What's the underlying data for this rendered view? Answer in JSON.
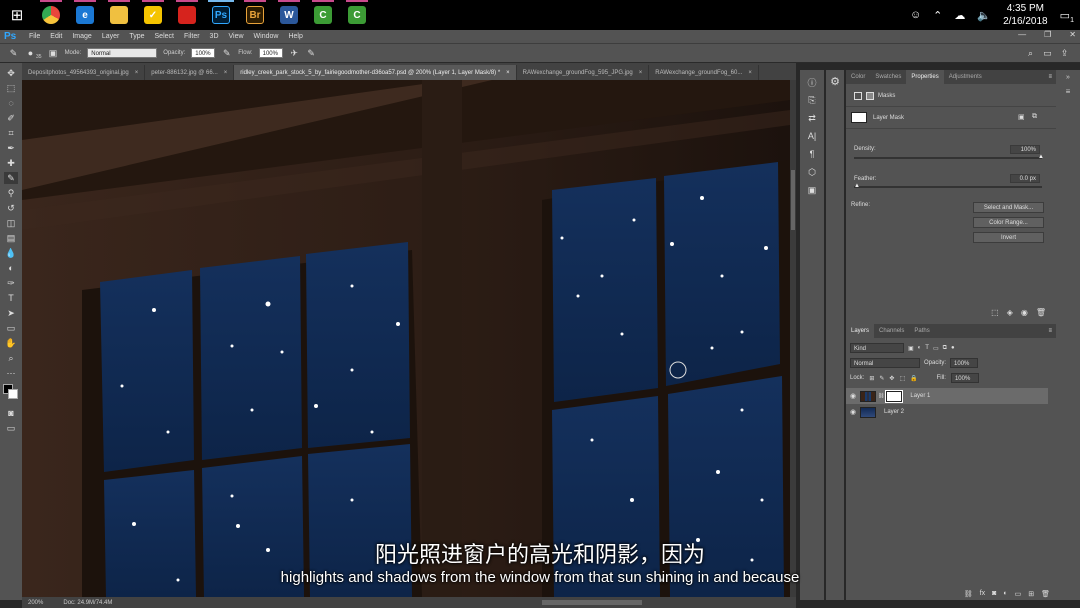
{
  "taskbar": {
    "time": "4:35 PM",
    "date": "2/16/2018",
    "notification_count": "1",
    "apps": [
      {
        "name": "chrome-icon",
        "label": "",
        "color": "#e8453c"
      },
      {
        "name": "edge-icon",
        "label": "e",
        "color": "#1b78d4"
      },
      {
        "name": "file-explorer-icon",
        "label": "",
        "color": "#f0c040"
      },
      {
        "name": "norton-icon",
        "label": "✓",
        "color": "#f5c400"
      },
      {
        "name": "app-red-icon",
        "label": "",
        "color": "#d6231d"
      },
      {
        "name": "photoshop-icon",
        "label": "Ps",
        "color": "#001d34"
      },
      {
        "name": "bridge-icon",
        "label": "Br",
        "color": "#2d1c00"
      },
      {
        "name": "word-icon",
        "label": "W",
        "color": "#2b579a"
      },
      {
        "name": "camtasia-icon",
        "label": "C",
        "color": "#3c9b35"
      },
      {
        "name": "camtasia-recorder-icon",
        "label": "C",
        "color": "#3c9b35"
      }
    ]
  },
  "menubar": {
    "logo": "Ps",
    "items": [
      "File",
      "Edit",
      "Image",
      "Layer",
      "Type",
      "Select",
      "Filter",
      "3D",
      "View",
      "Window",
      "Help"
    ]
  },
  "options": {
    "brush_size": "35",
    "mode_label": "Mode:",
    "mode_value": "Normal",
    "opacity_label": "Opacity:",
    "opacity_value": "100%",
    "flow_label": "Flow:",
    "flow_value": "100%"
  },
  "tabs": [
    {
      "label": "Depositphotos_49564393_original.jpg",
      "active": false
    },
    {
      "label": "peter-886132.jpg @ 66...",
      "active": false
    },
    {
      "label": "ridley_creek_park_stock_5_by_fairiegoodmother-d36oa57.psd @ 200% (Layer 1, Layer Mask/8) *",
      "active": true
    },
    {
      "label": "RAWexchange_groundFog_595_JPG.jpg",
      "active": false
    },
    {
      "label": "RAWexchange_groundFog_60...",
      "active": false
    }
  ],
  "status": {
    "zoom": "200%",
    "doc": "Doc: 24.9M/74.4M"
  },
  "properties": {
    "tabs": [
      "Color",
      "Swatches",
      "Properties",
      "Adjustments"
    ],
    "active_tab": "Properties",
    "masks_label": "Masks",
    "layer_mask_label": "Layer Mask",
    "density_label": "Density:",
    "density_value": "100%",
    "density_level": 1.0,
    "feather_label": "Feather:",
    "feather_value": "0.0 px",
    "feather_level": 0.0,
    "refine_label": "Refine:",
    "select_and_mask": "Select and Mask...",
    "color_range": "Color Range...",
    "invert": "Invert"
  },
  "layers": {
    "tabs": [
      "Layers",
      "Channels",
      "Paths"
    ],
    "active_tab": "Layers",
    "kind_label": "Kind",
    "blend_mode": "Normal",
    "opacity_label": "Opacity:",
    "opacity_value": "100%",
    "lock_label": "Lock:",
    "fill_label": "Fill:",
    "fill_value": "100%",
    "items": [
      {
        "name": "Layer 1",
        "selected": true
      },
      {
        "name": "Layer 2",
        "selected": false
      }
    ]
  },
  "subtitle": {
    "chinese": "阳光照进窗户的高光和阴影，因为",
    "english": "highlights and shadows from the window from that sun shining in and because"
  }
}
